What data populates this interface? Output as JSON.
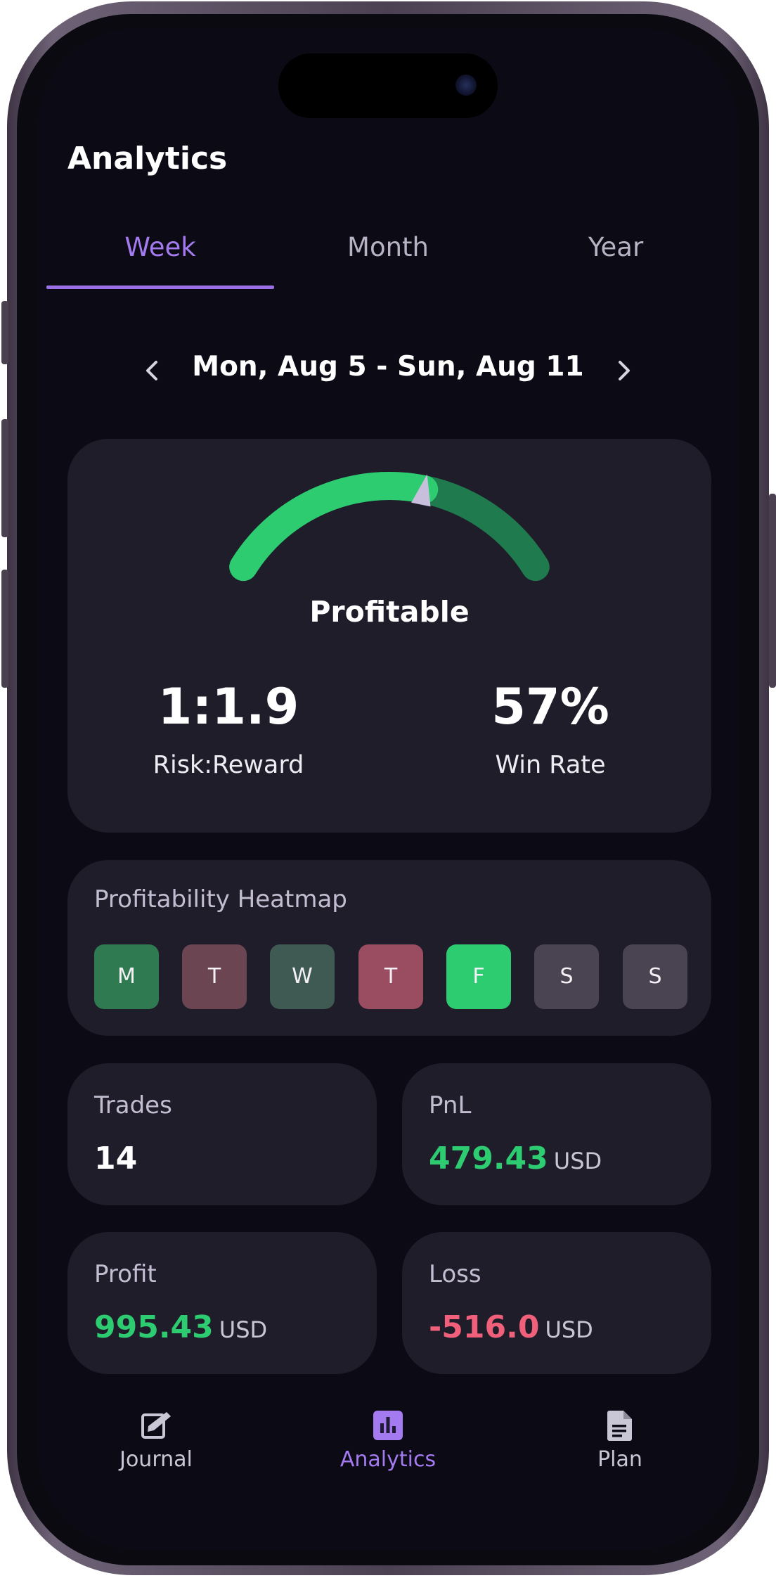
{
  "app": {
    "title": "Analytics"
  },
  "tabs": [
    {
      "label": "Week",
      "active": true
    },
    {
      "label": "Month",
      "active": false
    },
    {
      "label": "Year",
      "active": false
    }
  ],
  "date_nav": {
    "range": "Mon, Aug 5 - Sun, Aug 11",
    "prev_icon": "chevron-left-icon",
    "next_icon": "chevron-right-icon"
  },
  "gauge": {
    "status": "Profitable",
    "indicator_fraction": 0.6,
    "colors": {
      "filled": "#2ecc71",
      "track": "#1f7a4e",
      "needle": "#c7bfdc"
    },
    "risk_reward": {
      "value": "1:1.9",
      "label": "Risk:Reward"
    },
    "win_rate": {
      "value": "57%",
      "label": "Win Rate"
    }
  },
  "heatmap": {
    "title": "Profitability Heatmap",
    "days": [
      {
        "label": "M",
        "color": "#2f7a50"
      },
      {
        "label": "T",
        "color": "#6b4552"
      },
      {
        "label": "W",
        "color": "#3f5a52"
      },
      {
        "label": "T",
        "color": "#9a4d60"
      },
      {
        "label": "F",
        "color": "#2ecc71"
      },
      {
        "label": "S",
        "color": "#4a4452"
      },
      {
        "label": "S",
        "color": "#4a4452"
      }
    ]
  },
  "stats": {
    "trades": {
      "label": "Trades",
      "value": "14"
    },
    "pnl": {
      "label": "PnL",
      "value": "479.43",
      "unit": "USD",
      "color": "#2ecc71"
    },
    "profit": {
      "label": "Profit",
      "value": "995.43",
      "unit": "USD",
      "color": "#2ecc71"
    },
    "loss": {
      "label": "Loss",
      "value": "-516.0",
      "unit": "USD",
      "color": "#f0607a"
    }
  },
  "bottom_nav": [
    {
      "label": "Journal",
      "icon": "journal-icon",
      "active": false
    },
    {
      "label": "Analytics",
      "icon": "bar-chart-icon",
      "active": true
    },
    {
      "label": "Plan",
      "icon": "document-icon",
      "active": false
    }
  ]
}
